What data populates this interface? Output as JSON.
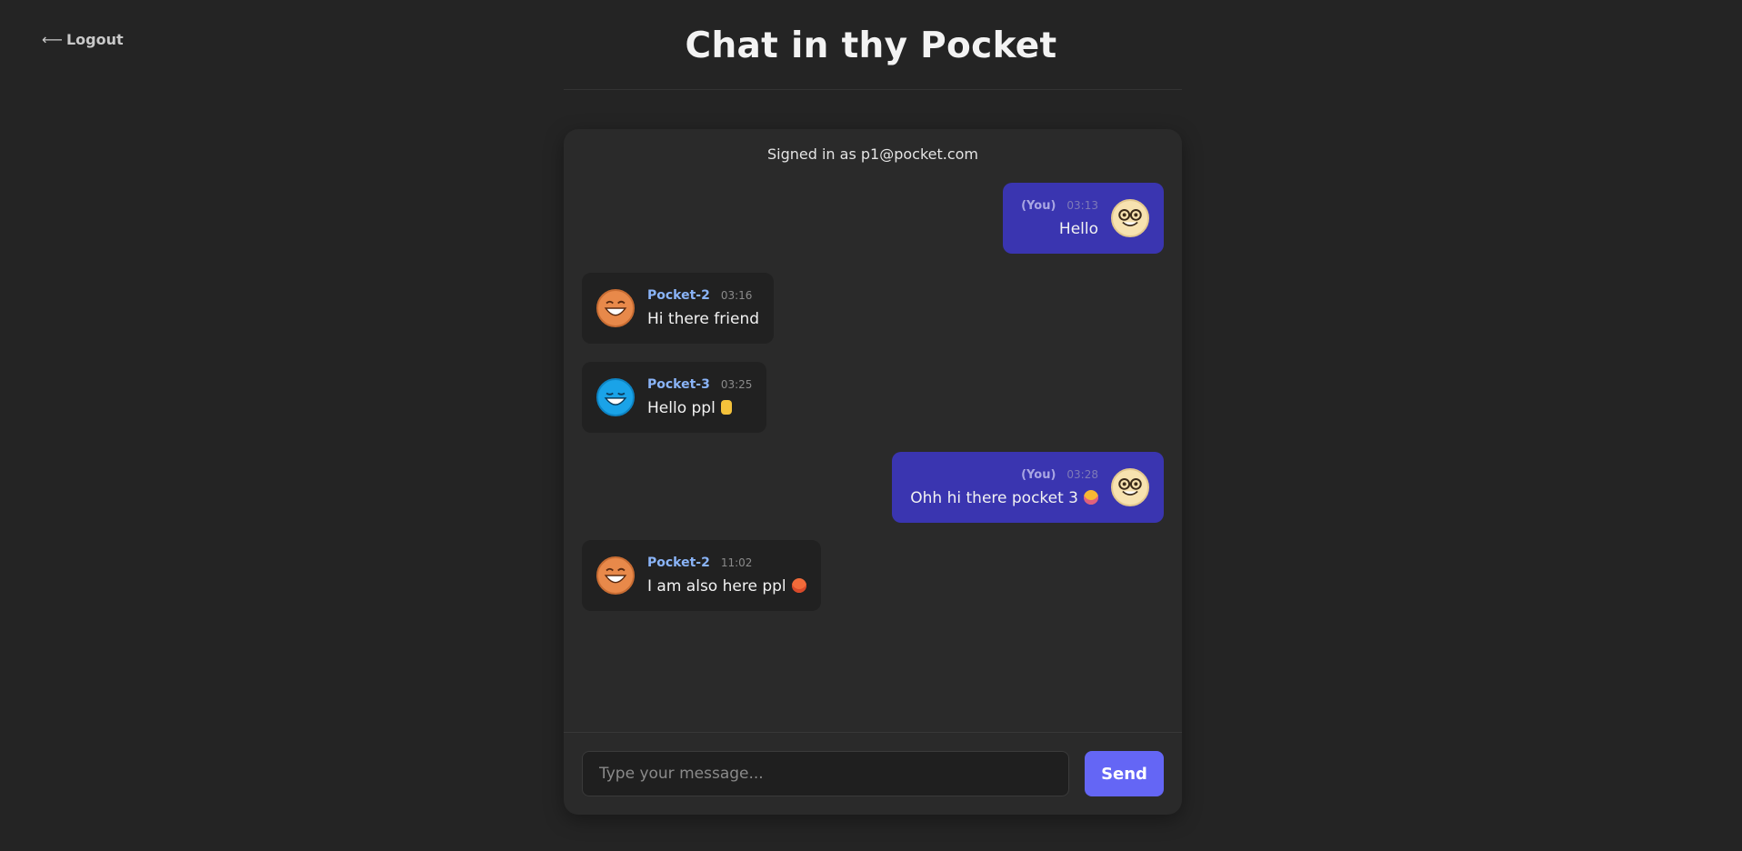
{
  "header": {
    "logout_arrow": "⟵",
    "logout_label": "Logout",
    "title": "Chat in thy Pocket"
  },
  "chat": {
    "signed_in": "Signed in as p1@pocket.com",
    "messages": [
      {
        "sender": "(You)",
        "time": "03:13",
        "text": "Hello",
        "mine": true,
        "avatar": "nerd-face-icon"
      },
      {
        "sender": "Pocket-2",
        "time": "03:16",
        "text": "Hi there friend",
        "mine": false,
        "avatar": "grinning-face-icon"
      },
      {
        "sender": "Pocket-3",
        "time": "03:25",
        "text": "Hello ppl",
        "mine": false,
        "avatar": "grinning-face-blue-icon",
        "emoji": "victory-hand-emoji"
      },
      {
        "sender": "(You)",
        "time": "03:28",
        "text": "Ohh hi there pocket 3",
        "mine": true,
        "avatar": "nerd-face-icon",
        "emoji": "crying-face-emoji"
      },
      {
        "sender": "Pocket-2",
        "time": "11:02",
        "text": "I am also here ppl",
        "mine": false,
        "avatar": "grinning-face-icon",
        "emoji": "hot-face-emoji"
      }
    ]
  },
  "composer": {
    "placeholder": "Type your message...",
    "send_label": "Send"
  },
  "colors": {
    "background": "#242424",
    "panel": "#2a2a2a",
    "my_bubble": "#3a35b0",
    "other_bubble": "#212121",
    "sender_name": "#8ab4f8",
    "send_button": "#6466f5"
  }
}
